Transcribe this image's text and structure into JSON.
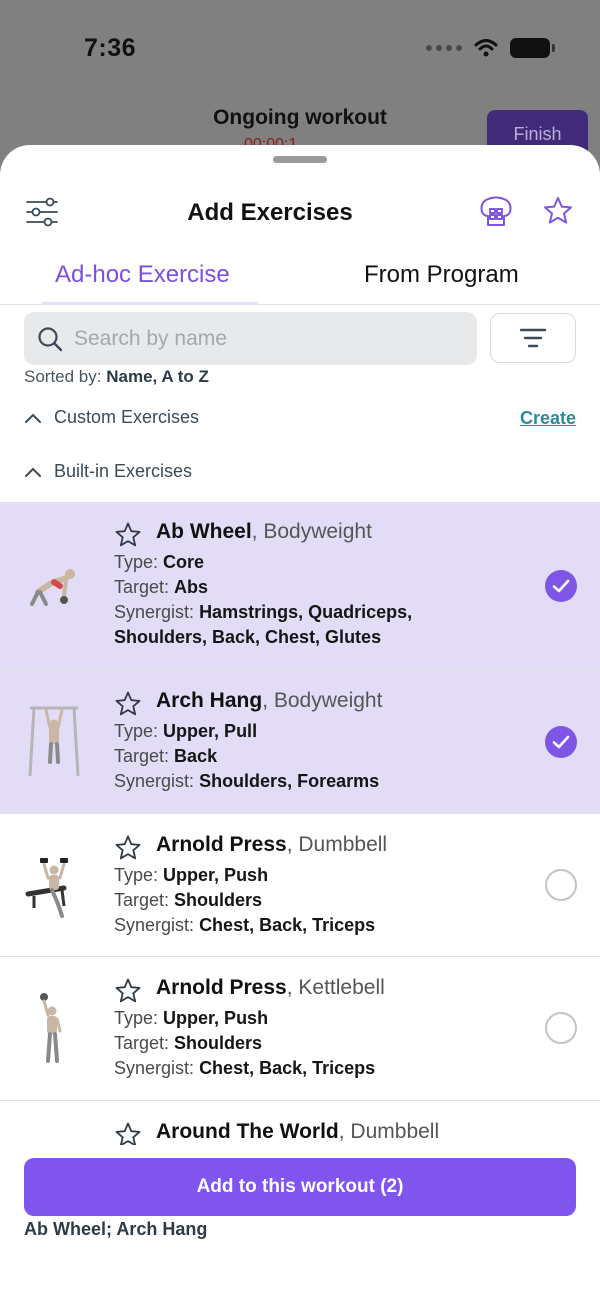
{
  "status_bar": {
    "time": "7:36"
  },
  "background": {
    "title": "Ongoing workout",
    "timer": "00:00:1",
    "finish_label": "Finish"
  },
  "header": {
    "title": "Add Exercises"
  },
  "tabs": [
    {
      "label": "Ad-hoc Exercise",
      "active": true
    },
    {
      "label": "From Program",
      "active": false
    }
  ],
  "search": {
    "placeholder": "Search by name",
    "value": ""
  },
  "sort": {
    "prefix": "Sorted by:",
    "value": "Name, A to Z"
  },
  "sections": {
    "custom": "Custom Exercises",
    "create_label": "Create",
    "builtin": "Built-in Exercises"
  },
  "exercises": [
    {
      "name": "Ab Wheel",
      "equipment": ", Bodyweight",
      "type_label": "Type:",
      "type": "Core",
      "target_label": "Target:",
      "target": "Abs",
      "synergist_label": "Synergist:",
      "synergist_1": "Hamstrings, Quadriceps,",
      "synergist_2": "Shoulders, Back, Chest, Glutes",
      "selected": true
    },
    {
      "name": "Arch Hang",
      "equipment": ", Bodyweight",
      "type_label": "Type:",
      "type": "Upper, Pull",
      "target_label": "Target:",
      "target": "Back",
      "synergist_label": "Synergist:",
      "synergist_1": "Shoulders, Forearms",
      "selected": true
    },
    {
      "name": "Arnold Press",
      "equipment": ", Dumbbell",
      "type_label": "Type:",
      "type": "Upper, Push",
      "target_label": "Target:",
      "target": "Shoulders",
      "synergist_label": "Synergist:",
      "synergist_1": "Chest, Back, Triceps",
      "selected": false
    },
    {
      "name": "Arnold Press",
      "equipment": ", Kettlebell",
      "type_label": "Type:",
      "type": "Upper, Push",
      "target_label": "Target:",
      "target": "Shoulders",
      "synergist_label": "Synergist:",
      "synergist_1": "Chest, Back, Triceps",
      "selected": false
    },
    {
      "name": "Around The World",
      "equipment": ", Dumbbell"
    }
  ],
  "footer": {
    "add_label": "Add to this workout (2)",
    "selected_summary": "Ab Wheel; Arch Hang"
  },
  "colors": {
    "accent": "#7F55EE",
    "selected_row": "#E3DCF6",
    "link": "#2B8A9A"
  },
  "icons": {
    "filter": "sliders-icon",
    "muscle": "muscle-body-icon",
    "favorite": "star-icon",
    "search": "search-icon",
    "sort": "sort-lines-icon",
    "collapse": "chevron-up-icon",
    "check": "checkmark-icon"
  }
}
